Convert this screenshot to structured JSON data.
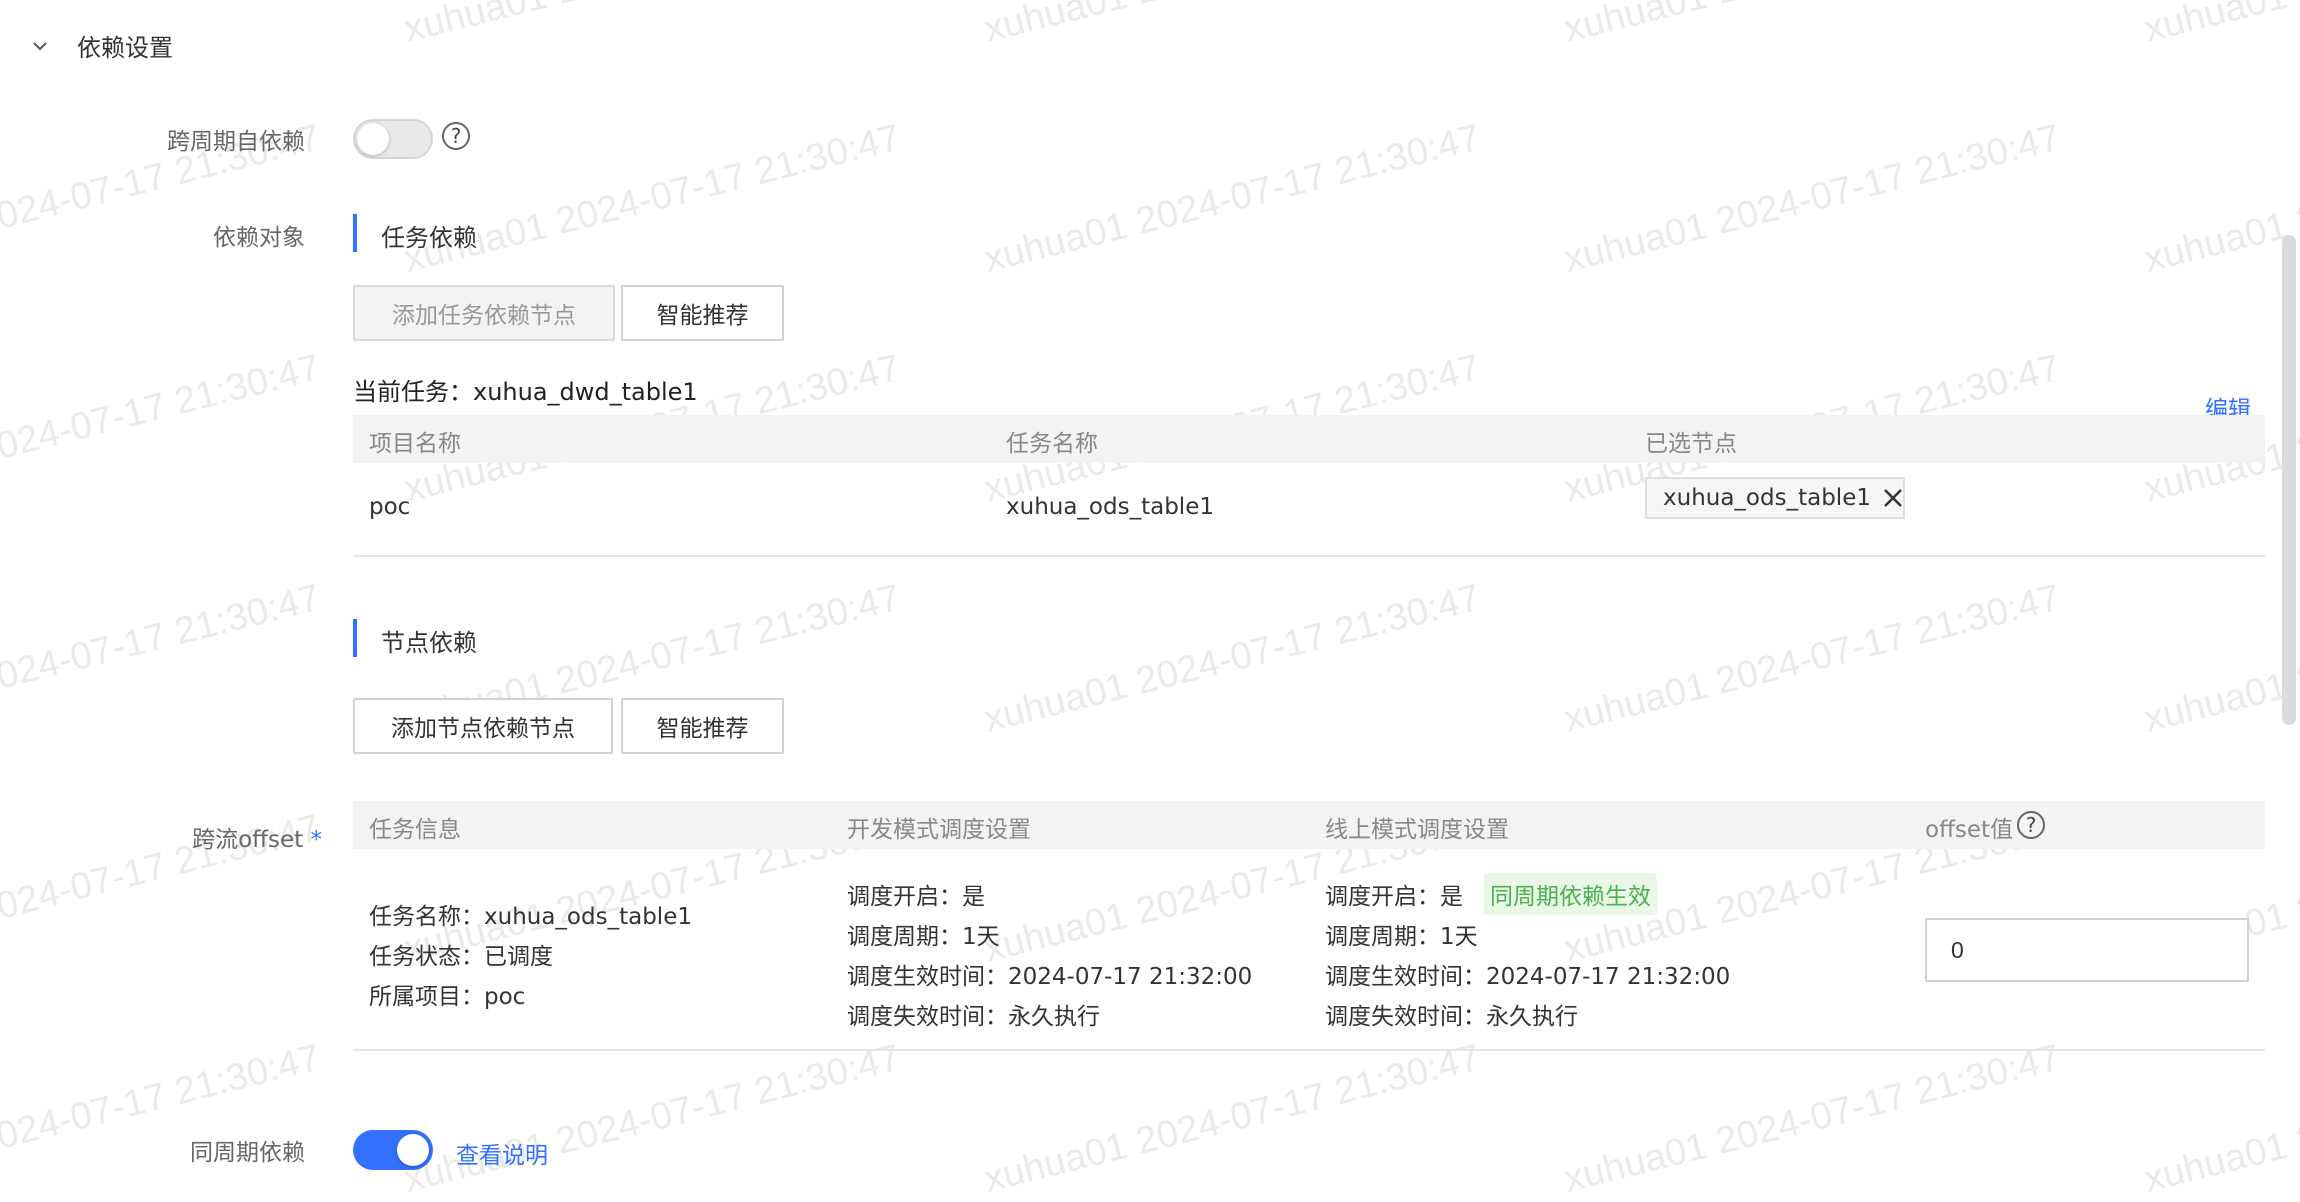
{
  "header": {
    "title": "依赖设置"
  },
  "cross_cycle_self": {
    "label": "跨周期自依赖",
    "enabled": false,
    "help": "?"
  },
  "dependency_object": {
    "label": "依赖对象"
  },
  "task_dependency": {
    "title": "任务依赖",
    "add_button": "添加任务依赖节点",
    "recommend_button": "智能推荐",
    "current_task_label": "当前任务：",
    "current_task_name": "xuhua_dwd_table1",
    "edit_link": "编辑",
    "columns": [
      "项目名称",
      "任务名称",
      "已选节点"
    ],
    "rows": [
      {
        "project": "poc",
        "task": "xuhua_ods_table1",
        "selected_node": "xuhua_ods_table1"
      }
    ]
  },
  "node_dependency": {
    "title": "节点依赖",
    "add_button": "添加节点依赖节点",
    "recommend_button": "智能推荐"
  },
  "cross_flow_offset": {
    "label": "跨流offset",
    "required_mark": "*",
    "columns": [
      "任务信息",
      "开发模式调度设置",
      "线上模式调度设置",
      "offset值"
    ],
    "offset_help": "?",
    "task_info": [
      "任务名称：xuhua_ods_table1",
      "任务状态：已调度",
      "所属项目：poc"
    ],
    "dev_settings": [
      "调度开启：是",
      "调度周期：1天",
      "调度生效时间：2024-07-17 21:32:00",
      "调度失效时间：永久执行"
    ],
    "online_settings": {
      "enabled_line": "调度开启：是",
      "badge": "同周期依赖生效",
      "lines": [
        "调度周期：1天",
        "调度生效时间：2024-07-17 21:32:00",
        "调度失效时间：永久执行"
      ]
    },
    "offset_value": "0"
  },
  "same_cycle": {
    "label": "同周期依赖",
    "enabled": true,
    "link": "查看说明"
  },
  "watermark": {
    "text": "xuhua01 2024-07-17 21:30:47"
  },
  "colors": {
    "accent": "#3370ff",
    "badge_green": "#4caf50"
  }
}
